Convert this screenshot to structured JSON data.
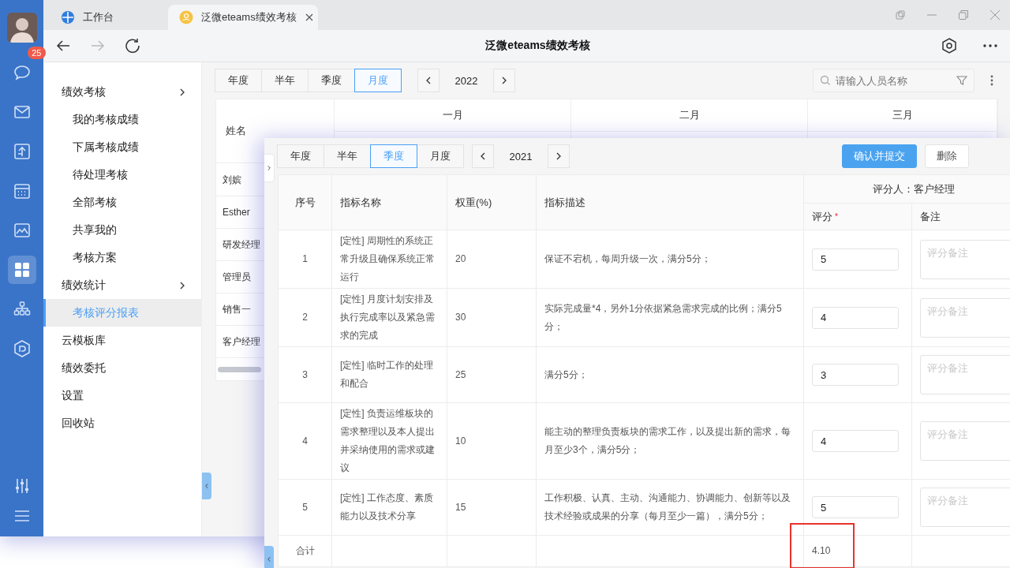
{
  "rail": {
    "items": [
      {
        "kind": "chat",
        "selected": false,
        "badge": "25"
      },
      {
        "kind": "mail",
        "selected": false
      },
      {
        "kind": "board",
        "selected": false
      },
      {
        "kind": "calendar",
        "selected": false
      },
      {
        "kind": "image",
        "selected": false
      },
      {
        "kind": "apps",
        "selected": true
      },
      {
        "kind": "org",
        "selected": false
      },
      {
        "kind": "cube",
        "selected": false
      }
    ],
    "bottom": [
      {
        "kind": "sliders"
      },
      {
        "kind": "menu"
      }
    ]
  },
  "tabs": [
    {
      "label": "工作台",
      "selected": false,
      "kind": "workbench"
    },
    {
      "label": "泛微eteams绩效考核",
      "selected": true,
      "kind": "app"
    }
  ],
  "toolbar": {
    "title": "泛微eteams绩效考核",
    "forward_disabled": true
  },
  "sidebar": {
    "items": [
      {
        "label": "绩效考核",
        "selected": false,
        "children": [
          {
            "label": "我的考核成绩",
            "selected": false
          },
          {
            "label": "下属考核成绩",
            "selected": false
          },
          {
            "label": "待处理考核",
            "selected": false
          },
          {
            "label": "全部考核",
            "selected": false
          },
          {
            "label": "共享我的",
            "selected": false
          },
          {
            "label": "考核方案",
            "selected": false
          }
        ]
      },
      {
        "label": "绩效统计",
        "selected": false,
        "children": [
          {
            "label": "考核评分报表",
            "selected": true
          }
        ]
      },
      {
        "label": "云模板库",
        "selected": false
      },
      {
        "label": "绩效委托",
        "selected": false
      },
      {
        "label": "设置",
        "selected": false
      },
      {
        "label": "回收站",
        "selected": false
      }
    ]
  },
  "main": {
    "period_tabs": [
      {
        "label": "年度",
        "selected": false
      },
      {
        "label": "半年",
        "selected": false
      },
      {
        "label": "季度",
        "selected": false
      },
      {
        "label": "月度",
        "selected": true
      }
    ],
    "year": "2022",
    "search": {
      "placeholder": "请输入人员名称"
    },
    "table": {
      "name_header": "姓名",
      "months": [
        "一月",
        "二月",
        "三月"
      ],
      "rows": [
        "刘嫔",
        "Esther",
        "研发经理",
        "管理员",
        "销售一",
        "客户经理"
      ]
    }
  },
  "overlay": {
    "period_tabs": [
      {
        "label": "年度",
        "selected": false
      },
      {
        "label": "半年",
        "selected": false
      },
      {
        "label": "季度",
        "selected": true
      },
      {
        "label": "月度",
        "selected": false
      }
    ],
    "year": "2021",
    "buttons": [
      {
        "label": "确认并提交",
        "kind": "primary"
      },
      {
        "label": "删除",
        "kind": "default"
      }
    ],
    "table": {
      "columns": [
        "序号",
        "指标名称",
        "权重(%)",
        "指标描述"
      ],
      "rater": "评分人：客户经理",
      "score_header": "评分",
      "score_required": true,
      "required_mark": "*",
      "remark_header": "备注",
      "rows": [
        {
          "no": "1",
          "name": "[定性] 周期性的系统正常升级且确保系统正常运行",
          "weight": "20",
          "description": "保证不宕机，每周升级一次，满分5分；",
          "score": "5",
          "remark_placeholder": "评分备注"
        },
        {
          "no": "2",
          "name": "[定性] 月度计划安排及执行完成率以及紧急需求的完成",
          "weight": "30",
          "description": "实际完成量*4，另外1分依据紧急需求完成的比例；满分5分；",
          "score": "4",
          "remark_placeholder": "评分备注"
        },
        {
          "no": "3",
          "name": "[定性] 临时工作的处理和配合",
          "weight": "25",
          "description": "满分5分；",
          "score": "3",
          "remark_placeholder": "评分备注"
        },
        {
          "no": "4",
          "name": "[定性] 负责运维板块的需求整理以及本人提出并采纳使用的需求或建议",
          "weight": "10",
          "description": "能主动的整理负责板块的需求工作，以及提出新的需求，每月至少3个，满分5分；",
          "score": "4",
          "remark_placeholder": "评分备注"
        },
        {
          "no": "5",
          "name": "[定性] 工作态度、素质能力以及技术分享",
          "weight": "15",
          "description": "工作积极、认真、主动、沟通能力、协调能力、创新等以及技术经验或成果的分享（每月至少一篇），满分5分；",
          "score": "5",
          "remark_placeholder": "评分备注"
        }
      ],
      "total": {
        "label": "合计",
        "score": "4.10",
        "highlighted": true
      }
    }
  }
}
